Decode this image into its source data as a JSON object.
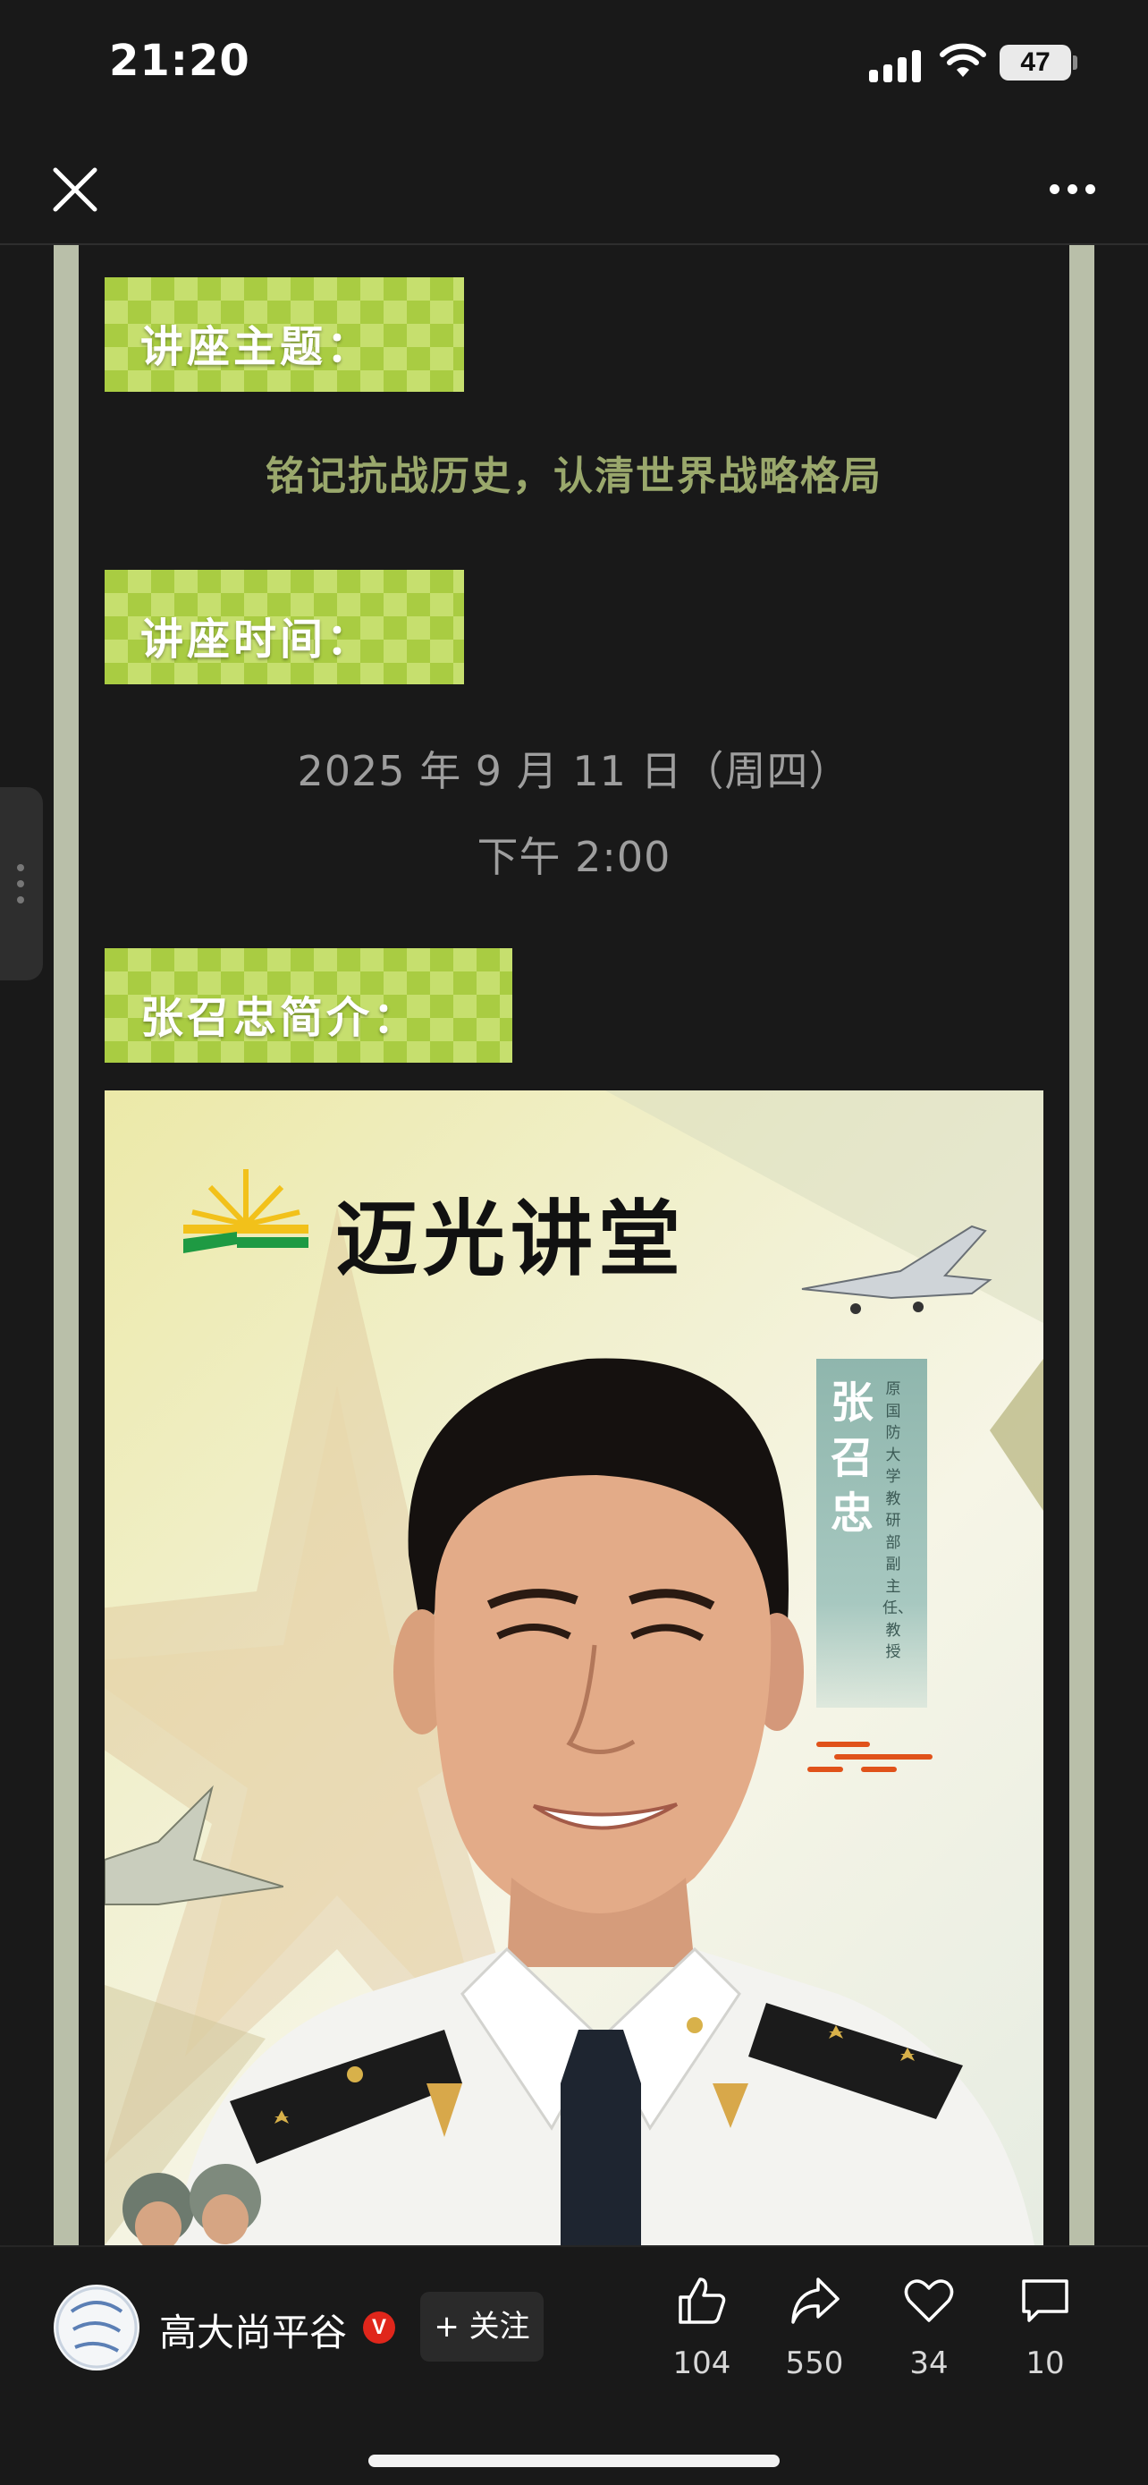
{
  "status_bar": {
    "time": "21:20",
    "battery_level": "47",
    "icons": [
      "cellular-signal-icon",
      "wifi-icon",
      "battery-icon"
    ]
  },
  "nav": {
    "icons": [
      "close-icon",
      "more-icon"
    ]
  },
  "article": {
    "sections": [
      {
        "heading": "讲座主题："
      },
      {
        "heading": "讲座时间："
      },
      {
        "heading": "张召忠简介："
      }
    ],
    "topic": "铭记抗战历史，认清世界战略格局",
    "date_line": "2025 年 9 月 11 日（周四）",
    "time_line": "下午 2:00",
    "poster": {
      "brand": "迈光讲堂",
      "name": "张召忠",
      "title": "原国防大学教研部副主任、教授"
    }
  },
  "bottom_bar": {
    "author": "高大尚平谷",
    "verified_badge": "V",
    "follow_label": "+ 关注",
    "actions": [
      {
        "icon": "like-icon",
        "count": "104"
      },
      {
        "icon": "share-icon",
        "count": "550"
      },
      {
        "icon": "heart-icon",
        "count": "34"
      },
      {
        "icon": "comment-icon",
        "count": "10"
      }
    ]
  },
  "colors": {
    "background": "#191919",
    "tag_green": "#a9cc42",
    "topic_text": "#9aa86c",
    "verified_red": "#e0261b"
  }
}
